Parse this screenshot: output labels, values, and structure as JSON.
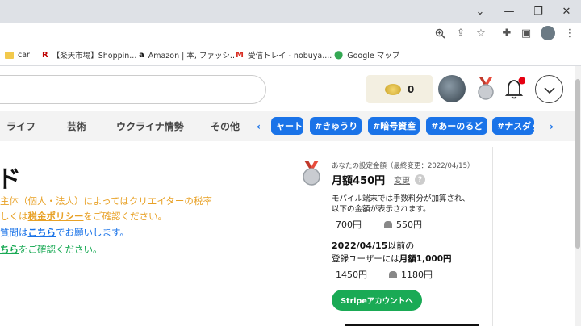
{
  "browser": {
    "bookmarks": [
      {
        "label": "car",
        "icon": "folder-icon"
      },
      {
        "label": "【楽天市場】Shoppin...",
        "icon": "rakuten-icon"
      },
      {
        "label": "Amazon | 本, ファッシ...",
        "icon": "amazon-icon"
      },
      {
        "label": "受信トレイ - nobuya....",
        "icon": "gmail-icon"
      },
      {
        "label": "Google マップ",
        "icon": "maps-icon"
      }
    ]
  },
  "header": {
    "coin_count": "0"
  },
  "nav": {
    "categories": [
      "ライフ",
      "芸術",
      "ウクライナ情勢",
      "その他"
    ],
    "tags": [
      "ャート",
      "#きゅうり",
      "#暗号資産",
      "#あーのるど",
      "#ナスダッ"
    ]
  },
  "main": {
    "title_fragment": "ド",
    "line1": "主体（個人・法人）によってはクリエイターの税率",
    "line2_prefix": "しくは",
    "line2_link": "税金ポリシー",
    "line2_suffix": "をご確認ください。",
    "line3_prefix": "質問は",
    "line3_link": "こちら",
    "line3_suffix": "でお願いします。",
    "line4_link": "ちら",
    "line4_suffix": "をご確認ください。"
  },
  "pricing": {
    "setting_label": "あなたの設定金額（最終変更：2022/04/15）",
    "monthly_price": "月額450円",
    "change_link": "変更",
    "help_icon": "?",
    "mobile_note_1": "モバイル端末では手数料分が加算され、",
    "mobile_note_2": "以下の金額が表示されます。",
    "apple_price": "700円",
    "android_price": "550円",
    "prior_date": "2022/04/15",
    "prior_suffix": "以前の",
    "registered_prefix": "登録ユーザーには",
    "registered_price": "月額1,000円",
    "prior_apple_price": "1450円",
    "prior_android_price": "1180円",
    "stripe_button": "Stripeアカウントへ"
  },
  "colors": {
    "accent_blue": "#1a73e8",
    "green": "#1aaa55",
    "orange": "#e8a126"
  }
}
